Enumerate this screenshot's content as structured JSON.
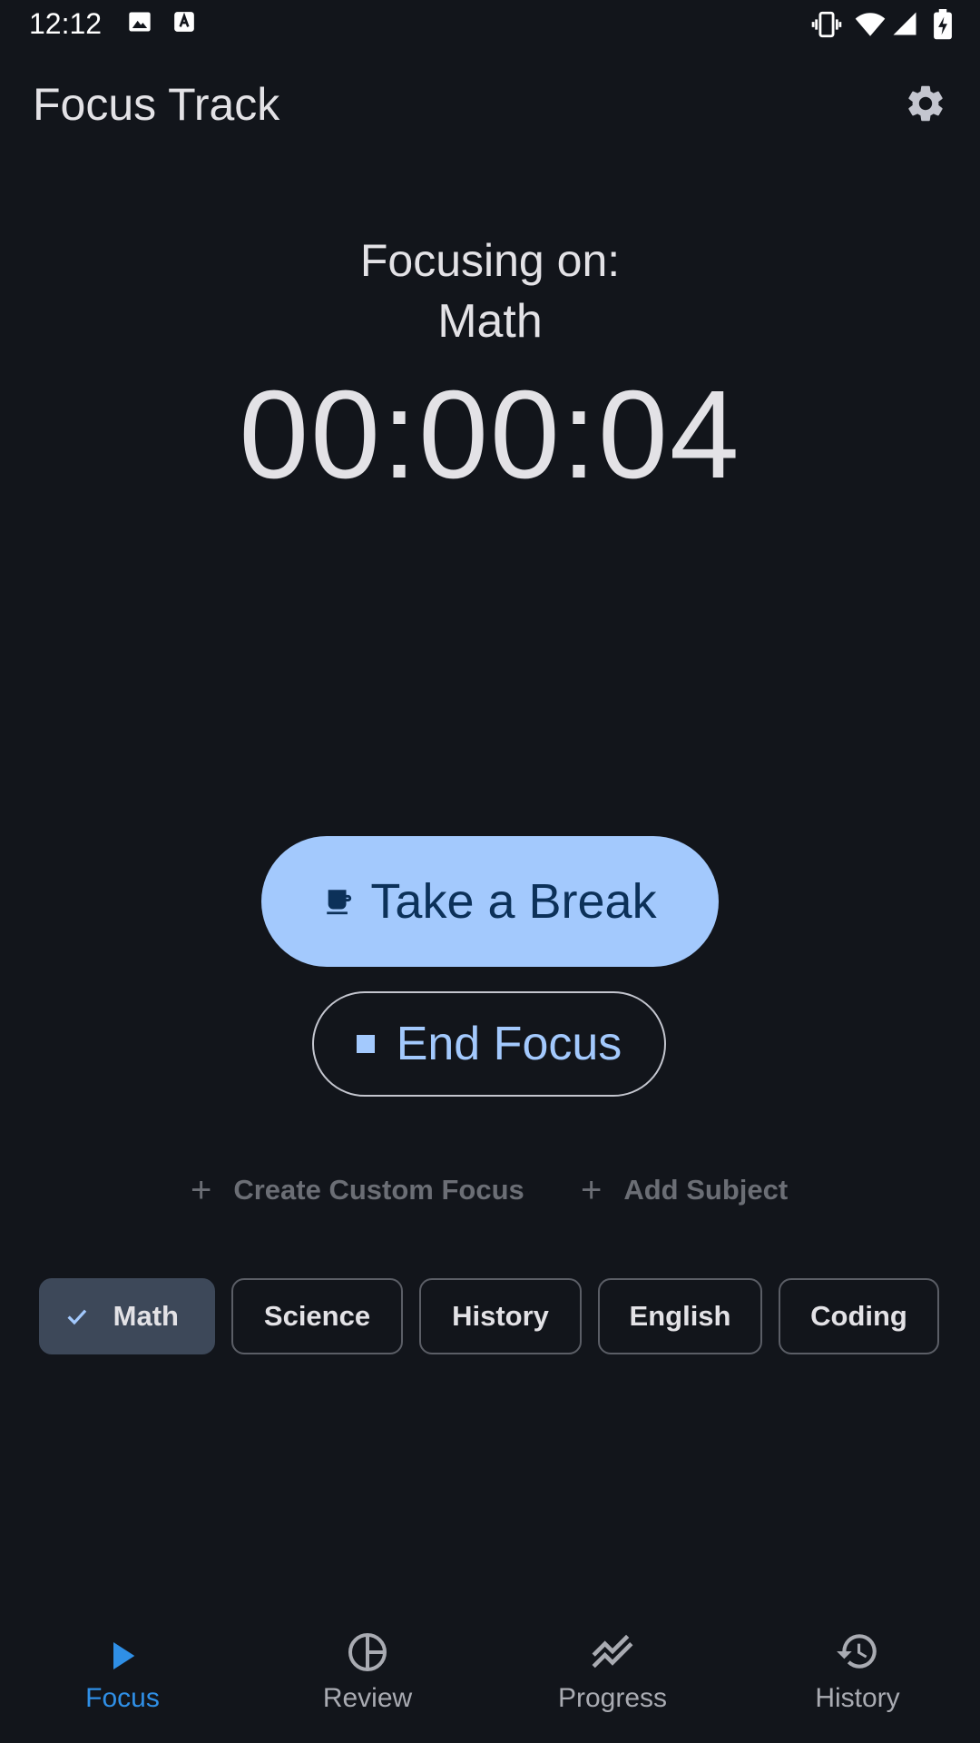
{
  "status_bar": {
    "time": "12:12",
    "left_icons": [
      "image-icon",
      "text-a-icon"
    ],
    "right_icons": [
      "vibrate-icon",
      "wifi-icon",
      "cell-signal-icon",
      "battery-charging-icon"
    ]
  },
  "app_bar": {
    "title": "Focus Track",
    "settings_icon": "gear-icon"
  },
  "focus": {
    "label": "Focusing on:",
    "subject": "Math",
    "timer": "00:00:04"
  },
  "actions": {
    "break_label": "Take a Break",
    "break_icon": "coffee-cup-icon",
    "end_label": "End Focus",
    "end_icon": "stop-square-icon",
    "create_custom_label": "Create Custom Focus",
    "add_subject_label": "Add Subject"
  },
  "subjects": [
    {
      "label": "Math",
      "selected": true
    },
    {
      "label": "Science",
      "selected": false
    },
    {
      "label": "History",
      "selected": false
    },
    {
      "label": "English",
      "selected": false
    },
    {
      "label": "Coding",
      "selected": false
    }
  ],
  "bottom_nav": [
    {
      "label": "Focus",
      "icon": "play-icon",
      "active": true
    },
    {
      "label": "Review",
      "icon": "pie-chart-icon",
      "active": false
    },
    {
      "label": "Progress",
      "icon": "trending-icon",
      "active": false
    },
    {
      "label": "History",
      "icon": "history-icon",
      "active": false
    }
  ],
  "colors": {
    "background": "#12151b",
    "primary": "#a3c9fd",
    "on_primary": "#0c3159",
    "active_nav": "#2f8fe6",
    "chip_selected": "#3d4859"
  }
}
